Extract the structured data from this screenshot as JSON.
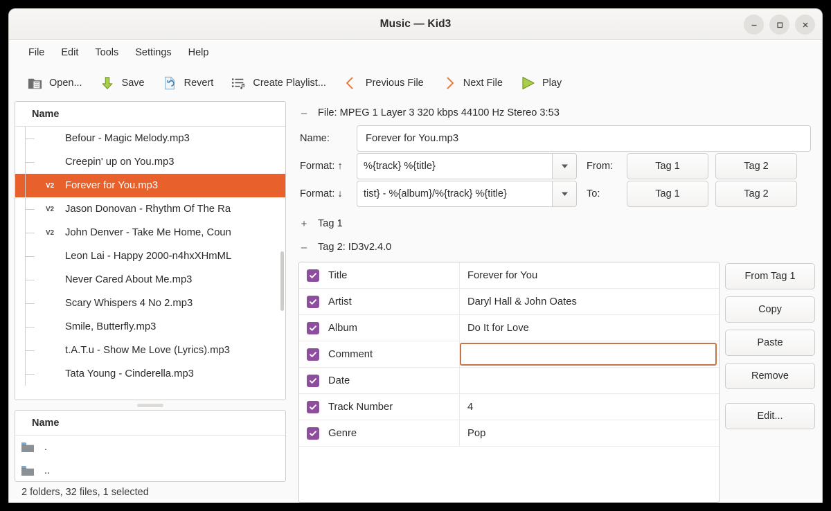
{
  "window": {
    "title": "Music  — Kid3",
    "controls": [
      {
        "name": "minimize",
        "glyph": "–"
      },
      {
        "name": "maximize",
        "glyph": "□"
      },
      {
        "name": "close",
        "glyph": "✕"
      }
    ]
  },
  "menubar": {
    "items": [
      "File",
      "Edit",
      "Tools",
      "Settings",
      "Help"
    ]
  },
  "toolbar": {
    "buttons": [
      {
        "label": "Open...",
        "icon": "folder-open-icon"
      },
      {
        "label": "Save",
        "icon": "save-down-arrow-icon"
      },
      {
        "label": "Revert",
        "icon": "revert-document-icon"
      },
      {
        "label": "Create Playlist...",
        "icon": "playlist-icon"
      },
      {
        "label": "Previous File",
        "icon": "chevron-left-icon"
      },
      {
        "label": "Next File",
        "icon": "chevron-right-icon"
      },
      {
        "label": "Play",
        "icon": "play-triangle-icon"
      }
    ]
  },
  "file_list": {
    "column_header": "Name",
    "rows": [
      {
        "name": "Befour - Magic  Melody.mp3",
        "badge": "",
        "selected": false
      },
      {
        "name": "Creepin' up on You.mp3",
        "badge": "",
        "selected": false
      },
      {
        "name": "Forever for You.mp3",
        "badge": "V2",
        "selected": true
      },
      {
        "name": "Jason Donovan - Rhythm Of The Ra",
        "badge": "V2",
        "selected": false
      },
      {
        "name": "John Denver - Take Me Home, Coun",
        "badge": "V2",
        "selected": false
      },
      {
        "name": "Leon Lai - Happy 2000-n4hxXHmML",
        "badge": "",
        "selected": false
      },
      {
        "name": "Never Cared About Me.mp3",
        "badge": "",
        "selected": false
      },
      {
        "name": "Scary Whispers 4 No 2.mp3",
        "badge": "",
        "selected": false
      },
      {
        "name": "Smile, Butterfly.mp3",
        "badge": "",
        "selected": false
      },
      {
        "name": "t.A.T.u - Show Me Love (Lyrics).mp3",
        "badge": "",
        "selected": false
      },
      {
        "name": "Tata Young - Cinderella.mp3",
        "badge": "",
        "selected": false
      }
    ]
  },
  "folder_list": {
    "column_header": "Name",
    "rows": [
      {
        "name": ".",
        "icon": "folder-icon"
      },
      {
        "name": "..",
        "icon": "folder-icon"
      }
    ]
  },
  "statusbar": {
    "text": "2 folders, 32 files, 1 selected"
  },
  "details": {
    "file_info_sign": "–",
    "file_info": "File: MPEG 1 Layer 3 320 kbps 44100 Hz Stereo 3:53",
    "name_label": "Name:",
    "name_value": "Forever for You.mp3",
    "format_up_label": "Format: ↑",
    "format_up_value": "%{track} %{title}",
    "format_down_label": "Format: ↓",
    "format_down_value": "tist} - %{album}/%{track} %{title}",
    "from_label": "From:",
    "to_label": "To:",
    "from_tag1": "Tag 1",
    "from_tag2": "Tag 2",
    "to_tag1": "Tag 1",
    "to_tag2": "Tag 2",
    "tag1_sign": "+",
    "tag1_header": "Tag 1",
    "tag2_sign": "–",
    "tag2_header": "Tag 2: ID3v2.4.0"
  },
  "tag_table": {
    "rows": [
      {
        "field": "Title",
        "value": "Forever for You",
        "checked": true,
        "editing": false
      },
      {
        "field": "Artist",
        "value": "Daryl Hall & John Oates",
        "checked": true,
        "editing": false
      },
      {
        "field": "Album",
        "value": "Do It for Love",
        "checked": true,
        "editing": false
      },
      {
        "field": "Comment",
        "value": "",
        "checked": true,
        "editing": true
      },
      {
        "field": "Date",
        "value": "",
        "checked": true,
        "editing": false
      },
      {
        "field": "Track Number",
        "value": "4",
        "checked": true,
        "editing": false
      },
      {
        "field": "Genre",
        "value": "Pop",
        "checked": true,
        "editing": false
      }
    ]
  },
  "tag_buttons": [
    {
      "label": "From Tag 1",
      "gap": false
    },
    {
      "label": "Copy",
      "gap": false
    },
    {
      "label": "Paste",
      "gap": false
    },
    {
      "label": "Remove",
      "gap": false
    },
    {
      "label": "Edit...",
      "gap": true
    }
  ],
  "colors": {
    "selection_orange": "#e8602b",
    "checkbox_purple": "#8e4e9e",
    "focus_border": "#c5744b",
    "toolbar_green": "#8fbf3f",
    "toolbar_orange": "#e8793a"
  }
}
